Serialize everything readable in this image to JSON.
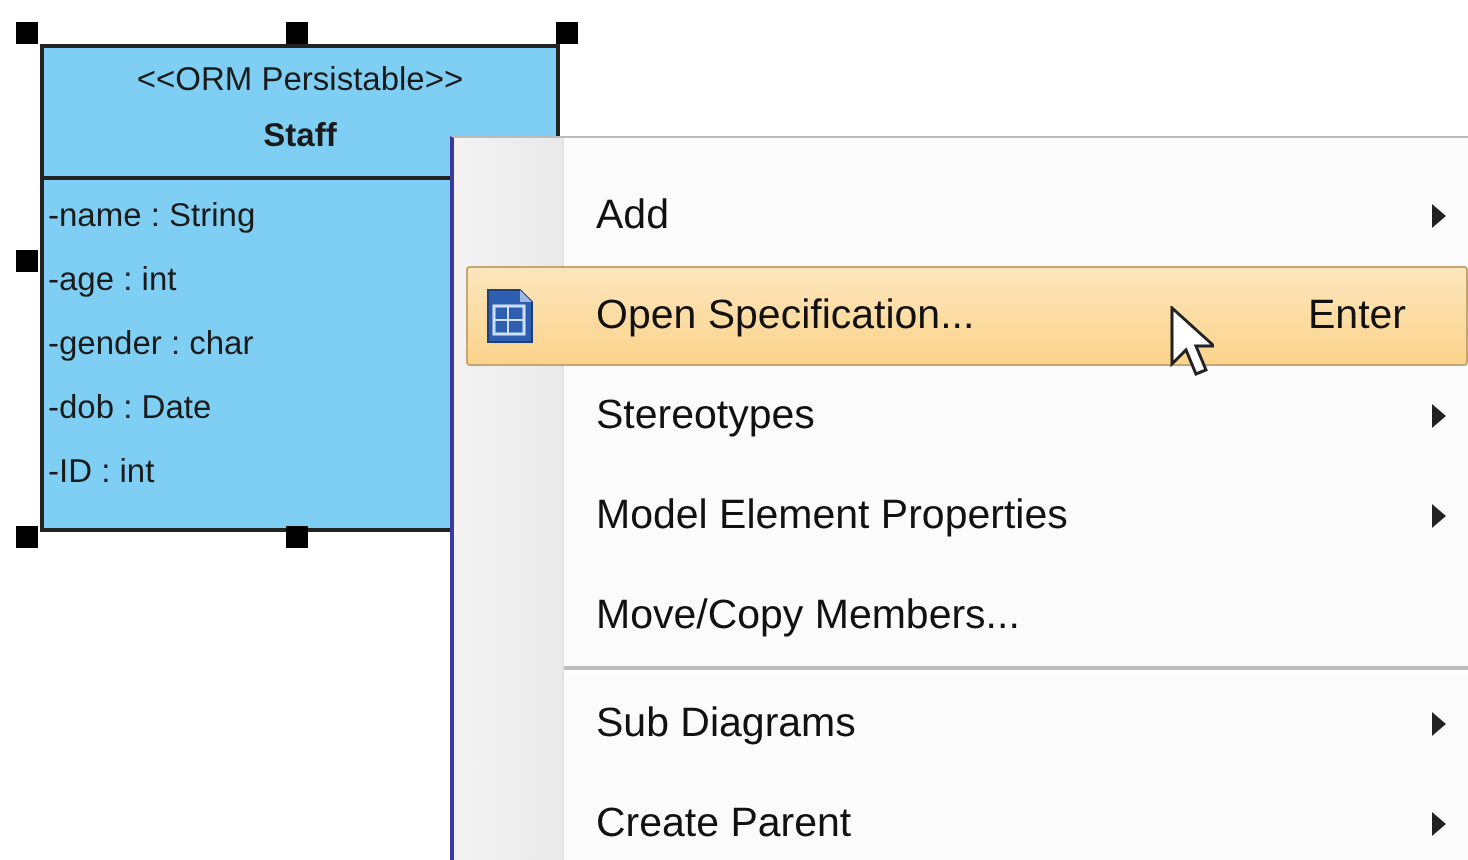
{
  "class_box": {
    "selected": true,
    "stereotype": "<<ORM Persistable>>",
    "name": "Staff",
    "attributes": [
      "-name : String",
      "-age : int",
      "-gender : char",
      "-dob : Date",
      "-ID : int"
    ]
  },
  "context_menu": {
    "items": [
      {
        "kind": "item",
        "label": "Add",
        "submenu": true,
        "selected": false,
        "icon": false
      },
      {
        "kind": "item",
        "label": "Open Specification...",
        "shortcut": "Enter",
        "submenu": false,
        "selected": true,
        "icon": true
      },
      {
        "kind": "item",
        "label": "Stereotypes",
        "submenu": true,
        "selected": false,
        "icon": false
      },
      {
        "kind": "item",
        "label": "Model Element Properties",
        "submenu": true,
        "selected": false,
        "icon": false
      },
      {
        "kind": "item",
        "label": "Move/Copy Members...",
        "submenu": false,
        "selected": false,
        "icon": false
      },
      {
        "kind": "separator"
      },
      {
        "kind": "item",
        "label": "Sub Diagrams",
        "submenu": true,
        "selected": false,
        "icon": false
      },
      {
        "kind": "item",
        "label": "Create Parent",
        "submenu": true,
        "selected": false,
        "icon": false
      }
    ]
  }
}
